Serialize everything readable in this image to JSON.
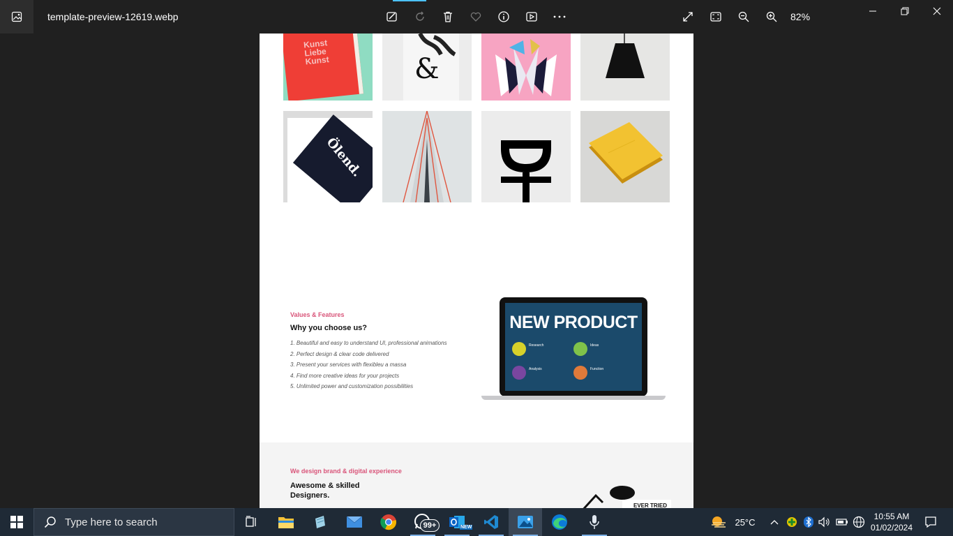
{
  "viewer": {
    "file_name": "template-preview-12619.webp",
    "zoom": "82%",
    "toolbar_icons": [
      "edit-image-icon",
      "rotate-icon",
      "delete-icon",
      "favorite-icon",
      "info-icon",
      "slideshow-icon",
      "more-icon",
      "fullscreen-icon",
      "fit-to-window-icon",
      "zoom-out-icon",
      "zoom-in-icon"
    ]
  },
  "page": {
    "gallery": {
      "book_text": "Kunst\nLiebe\nKunst",
      "ampersand": "&",
      "shirt_text": "Ölend."
    },
    "features": {
      "label": "Values & Features",
      "title": "Why you choose us?",
      "items": [
        "1. Beautiful and easy to understand UI, professional animations",
        "2. Perfect design & clear code delivered",
        "3. Present your services with flexibleu a massa",
        "4. Find more creative ideas for your projects",
        "5. Unlimited power and customization possibilities"
      ]
    },
    "laptop": {
      "headline": "NEW PRODUCT",
      "blocks": [
        "Research",
        "Ideas",
        "Analysis",
        "Function"
      ]
    },
    "brand": {
      "label": "We design brand & digital experience",
      "title_line1": "Awesome & skilled",
      "title_line2": "Designers.",
      "sign_text": "EVER TRIED"
    }
  },
  "taskbar": {
    "search_placeholder": "Type here to search",
    "whatsapp_badge": "99+",
    "outlook_badge": "NEW",
    "weather": "25°C",
    "time": "10:55 AM",
    "date": "01/02/2024"
  },
  "colors": {
    "accent_pink": "#d9557a",
    "taskbar_bg": "#1f2a36",
    "title_bg": "#202020"
  }
}
